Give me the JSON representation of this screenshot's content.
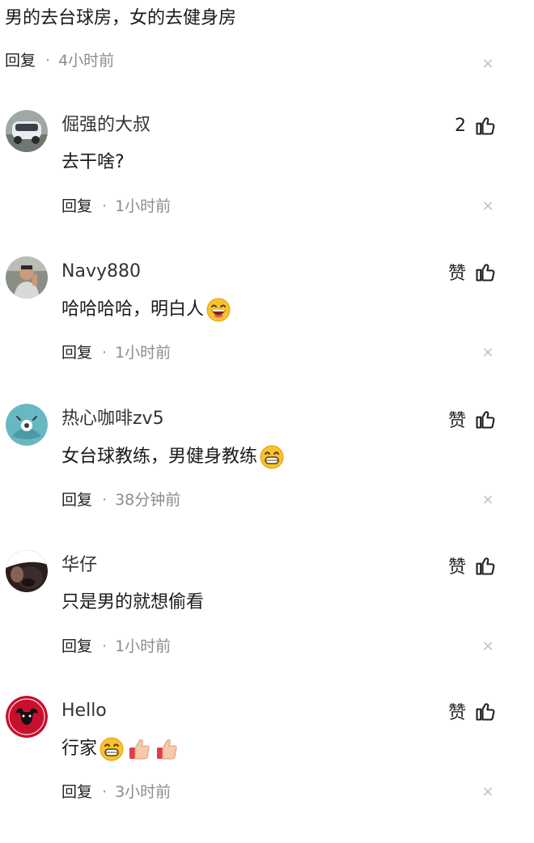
{
  "top_comment": {
    "text": "男的去台球房，女的去健身房",
    "reply_label": "回复",
    "separator": "·",
    "time": "4小时前",
    "close_glyph": "×"
  },
  "comments": [
    {
      "username": "倔强的大叔",
      "content": "去干啥?",
      "like_label": "2",
      "reply_label": "回复",
      "separator": "·",
      "time": "1小时前",
      "close_glyph": "×",
      "avatar_icon": "car-avatar",
      "emojis": []
    },
    {
      "username": "Navy880",
      "content": "哈哈哈哈，明白人",
      "like_label": "赞",
      "reply_label": "回复",
      "separator": "·",
      "time": "1小时前",
      "close_glyph": "×",
      "avatar_icon": "person-avatar",
      "emojis": [
        "laughing-emoji"
      ]
    },
    {
      "username": "热心咖啡zv5",
      "content": "女台球教练，男健身教练",
      "like_label": "赞",
      "reply_label": "回复",
      "separator": "·",
      "time": "38分钟前",
      "close_glyph": "×",
      "avatar_icon": "default-avatar",
      "emojis": [
        "grinning-emoji"
      ]
    },
    {
      "username": "华仔",
      "content": "只是男的就想偷看",
      "like_label": "赞",
      "reply_label": "回复",
      "separator": "·",
      "time": "1小时前",
      "close_glyph": "×",
      "avatar_icon": "dark-avatar",
      "emojis": []
    },
    {
      "username": "Hello",
      "content": "行家",
      "like_label": "赞",
      "reply_label": "回复",
      "separator": "·",
      "time": "3小时前",
      "close_glyph": "×",
      "avatar_icon": "bulls-logo-avatar",
      "avatar_text": "CHICAGO BULLS",
      "emojis": [
        "grinning-emoji",
        "thumbs-up-emoji",
        "thumbs-up-emoji"
      ]
    }
  ],
  "colors": {
    "text": "#1a1a1a",
    "meta": "#8c8c8c",
    "close": "#bdbdbd",
    "emoji_yellow": "#f7c22b",
    "bulls_red": "#c8102e"
  }
}
